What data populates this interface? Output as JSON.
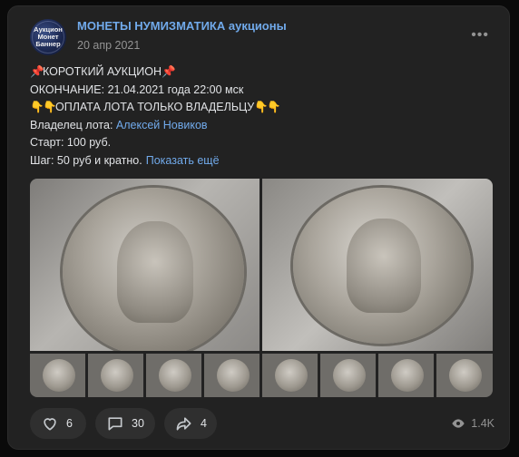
{
  "post": {
    "author": "МОНЕТЫ НУМИЗМАТИКА аукционы",
    "date": "20 апр 2021",
    "avatar_text": [
      "Аукцион",
      "Монет",
      "Баннер"
    ],
    "more_icon": "more-horizontal-icon"
  },
  "body": {
    "line1": "КОРОТКИЙ АУКЦИОН",
    "line2": "ОКОНЧАНИЕ: 21.04.2021 года 22:00 мск",
    "line3": "ОПЛАТА ЛОТА ТОЛЬКО ВЛАДЕЛЬЦУ",
    "owner_label": "Владелец лота:",
    "owner_name": "Алексей Новиков",
    "start": "Старт: 100 руб.",
    "step": "Шаг: 50 руб и кратно.",
    "show_more": "Показать ещё",
    "pin_emoji": "📌",
    "hand_emoji": "👇"
  },
  "gallery": {
    "large_count": 2,
    "thumb_count": 8
  },
  "actions": {
    "likes": "6",
    "comments": "30",
    "shares": "4",
    "views": "1.4K"
  },
  "colors": {
    "link": "#71aaeb",
    "card": "#222222",
    "pill": "#2f2f2f",
    "muted": "#939393"
  }
}
